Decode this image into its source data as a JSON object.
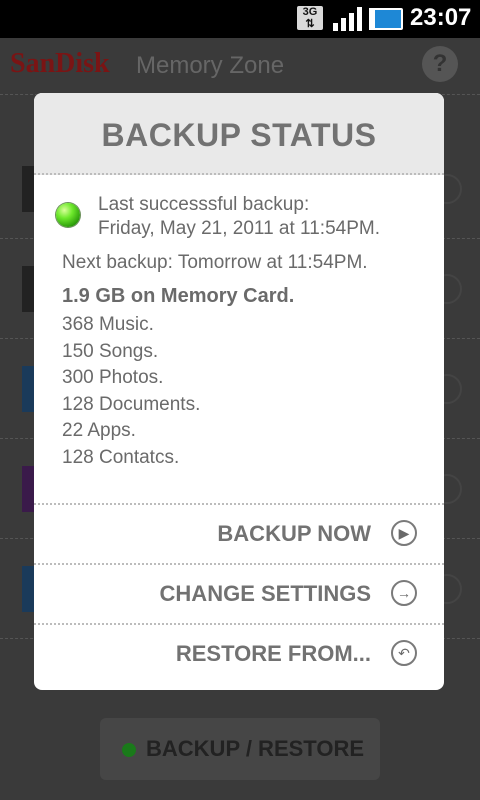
{
  "status_bar": {
    "network": "3G",
    "time": "23:07"
  },
  "app": {
    "brand": "SanDisk",
    "title": "Memory Zone",
    "help": "?",
    "bottom_button": "BACKUP / RESTORE"
  },
  "dialog": {
    "title": "BACKUP STATUS",
    "last_backup_label": "Last successsful backup:",
    "last_backup_date": "Friday, May 21, 2011 at 11:54PM.",
    "next_backup": "Next backup: Tomorrow at 11:54PM.",
    "storage_total": "1.9 GB on Memory Card.",
    "stats": [
      "368 Music.",
      "150 Songs.",
      "300 Photos.",
      "128 Documents.",
      "22 Apps.",
      "128 Contatcs."
    ],
    "actions": [
      {
        "label": "BACKUP NOW",
        "icon": "play-icon"
      },
      {
        "label": "CHANGE SETTINGS",
        "icon": "arrow-right-icon"
      },
      {
        "label": "RESTORE FROM...",
        "icon": "undo-icon"
      }
    ],
    "status_color": "#4fd11a"
  }
}
